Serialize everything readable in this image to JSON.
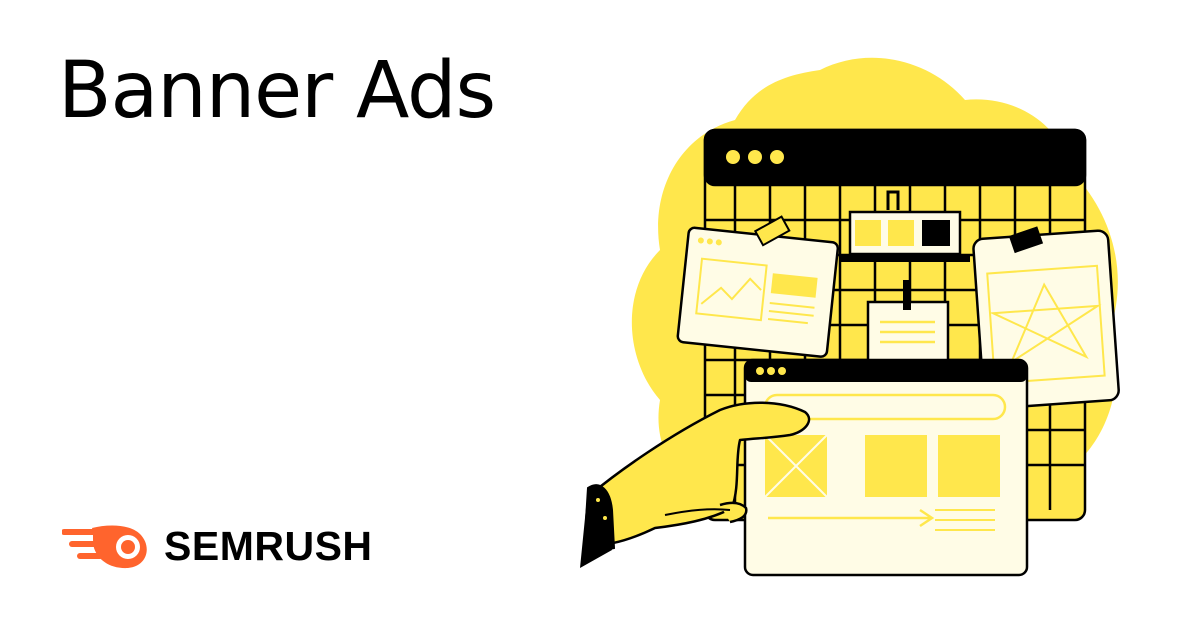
{
  "page": {
    "title": "Banner Ads"
  },
  "brand": {
    "name": "SEMRUSH",
    "color": "#FF642D"
  },
  "colors": {
    "accent": "#FFE74C",
    "ink": "#000000",
    "paper": "#FFFCE6"
  },
  "illustration": {
    "description_icon": "browser-windows-with-ad-layouts-icon"
  }
}
